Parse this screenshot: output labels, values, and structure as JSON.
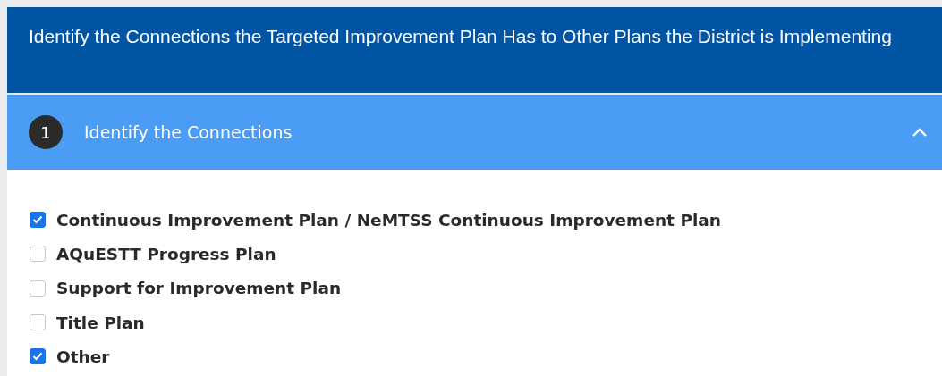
{
  "page_title": "Identify the Connections the Targeted Improvement Plan Has to Other Plans the District is Implementing",
  "section": {
    "number": "1",
    "title": "Identify the Connections",
    "expanded": true
  },
  "options": [
    {
      "label": "Continuous Improvement Plan / NeMTSS Continuous Improvement Plan",
      "checked": true
    },
    {
      "label": "AQuESTT Progress Plan",
      "checked": false
    },
    {
      "label": "Support for Improvement Plan",
      "checked": false
    },
    {
      "label": "Title Plan",
      "checked": false
    },
    {
      "label": "Other",
      "checked": true
    }
  ]
}
